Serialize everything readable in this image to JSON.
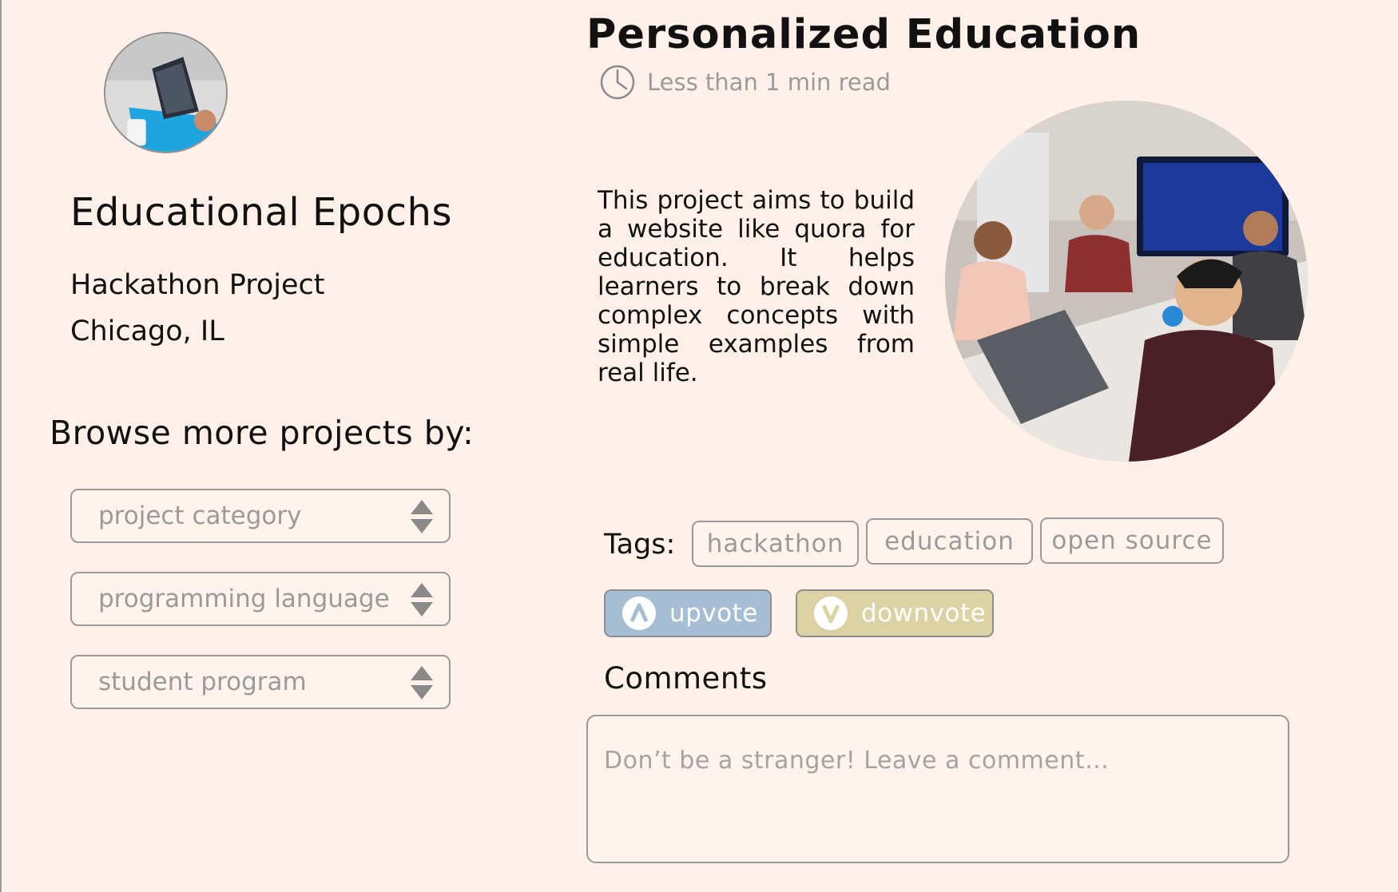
{
  "profile": {
    "avatar_icon": "laptop-photo",
    "name": "Educational Epochs",
    "subtitle": "Hackathon Project",
    "location": "Chicago, IL"
  },
  "browse": {
    "title": "Browse more projects by:",
    "filters": [
      {
        "placeholder": "project category"
      },
      {
        "placeholder": "programming language"
      },
      {
        "placeholder": "student program"
      }
    ]
  },
  "post": {
    "title": "Personalized Education",
    "read_time": "Less than 1 min read",
    "description": "This project aims to build a website like quora for education. It helps learners to break down complex concepts with simple examples from real life.",
    "photo_icon": "team-photo"
  },
  "tags": {
    "label": "Tags:",
    "items": [
      "hackathon",
      "education",
      "open source"
    ]
  },
  "votes": {
    "upvote_label": "upvote",
    "downvote_label": "downvote",
    "upvote_color": "#a5bed3",
    "downvote_color": "#ddd2a3"
  },
  "comments": {
    "title": "Comments",
    "placeholder": "Don’t be a stranger! Leave a comment…"
  },
  "colors": {
    "background": "#fff1ea",
    "border": "#9a9a9a",
    "muted_text": "#9a9a9a"
  }
}
